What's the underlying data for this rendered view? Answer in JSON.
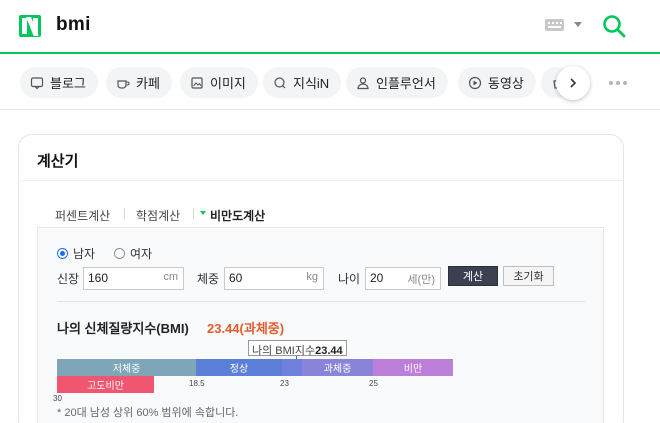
{
  "header": {
    "query": "bmi",
    "brand_color": "#03c75a"
  },
  "tabs": [
    {
      "label": "블로그",
      "icon": "blog-icon"
    },
    {
      "label": "카페",
      "icon": "cafe-icon"
    },
    {
      "label": "이미지",
      "icon": "image-icon"
    },
    {
      "label": "지식iN",
      "icon": "qna-icon"
    },
    {
      "label": "인플루언서",
      "icon": "person-icon"
    },
    {
      "label": "동영상",
      "icon": "play-icon"
    }
  ],
  "card": {
    "title": "계산기",
    "subtabs": [
      "퍼센트계산",
      "학점계산",
      "비만도계산"
    ],
    "active_subtab": "비만도계산"
  },
  "form": {
    "gender_male": "남자",
    "gender_female": "여자",
    "selected_gender": "남자",
    "height_label": "신장",
    "height_value": "160",
    "height_unit": "cm",
    "weight_label": "체중",
    "weight_value": "60",
    "weight_unit": "kg",
    "age_label": "나이",
    "age_value": "20",
    "age_unit": "세(만)",
    "calc_button": "계산",
    "reset_button": "초기화"
  },
  "result": {
    "title": "나의 신체질량지수(BMI)",
    "value": "23.44(과체중)",
    "marker_label": "나의 BMI지수",
    "marker_value": "23.44",
    "footnote": "* 20대 남성 상위 60% 범위에 속합니다."
  },
  "chart_data": {
    "type": "bar",
    "segments": [
      {
        "label": "저체중",
        "from": 0,
        "to": 18.5,
        "color": "#7ea6b8"
      },
      {
        "label": "정상",
        "from": 18.5,
        "to": 23,
        "color": "#5b7fd6"
      },
      {
        "label": "과체중",
        "from": 23,
        "to": 25,
        "color": "#8a84d8"
      },
      {
        "label": "비만",
        "from": 25,
        "to": 30,
        "color": "#bb7fd9"
      },
      {
        "label": "고도비만",
        "from": 30,
        "to": null,
        "color": "#f0566f"
      }
    ],
    "ticks": [
      "18.5",
      "23",
      "25",
      "30"
    ],
    "marker": 23.44
  }
}
